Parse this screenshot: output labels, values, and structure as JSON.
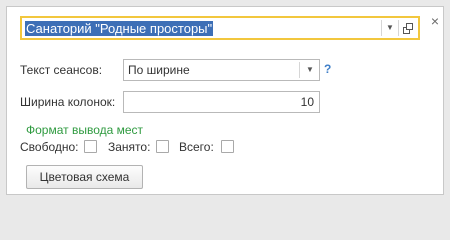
{
  "header": {
    "title_value": "Санаторий \"Родные просторы\"",
    "close_glyph": "×",
    "dropdown_glyph": "▼"
  },
  "form": {
    "sessions_text": {
      "label": "Текст сеансов:",
      "value": "По ширине",
      "help": "?"
    },
    "column_width": {
      "label": "Ширина колонок:",
      "value": "10"
    },
    "seats_format": {
      "title": "Формат вывода мест",
      "free_label": "Свободно:",
      "busy_label": "Занято:",
      "total_label": "Всего:",
      "free_checked": false,
      "busy_checked": false,
      "total_checked": false
    },
    "color_scheme_button": "Цветовая схема"
  },
  "colors": {
    "focus_border": "#f2c73d",
    "selection": "#3d6fb6",
    "group_title": "#2e9a3f",
    "help_link": "#3f7fc8"
  }
}
